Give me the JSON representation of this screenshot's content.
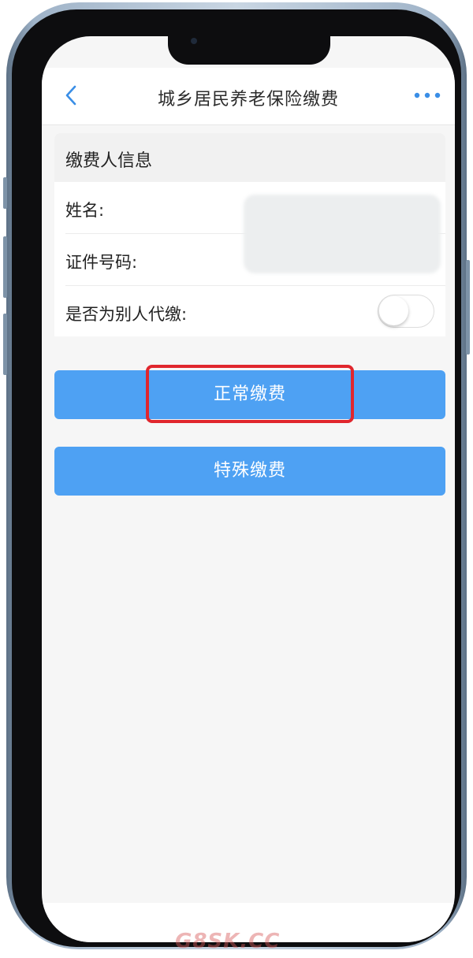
{
  "nav": {
    "title": "城乡居民养老保险缴费",
    "back_icon": "chevron-left-icon",
    "more_icon": "more-horizontal-icon"
  },
  "payer_section": {
    "title": "缴费人信息",
    "name_label": "姓名:",
    "id_label": "证件号码:",
    "proxy_label": "是否为别人代缴:",
    "proxy_toggle_on": false
  },
  "buttons": {
    "normal_payment": "正常缴费",
    "special_payment": "特殊缴费"
  },
  "watermark": "G8SK.CC",
  "colors": {
    "accent": "#4ea1f3",
    "highlight": "#e0262d",
    "back_icon": "#3a8ee6"
  }
}
